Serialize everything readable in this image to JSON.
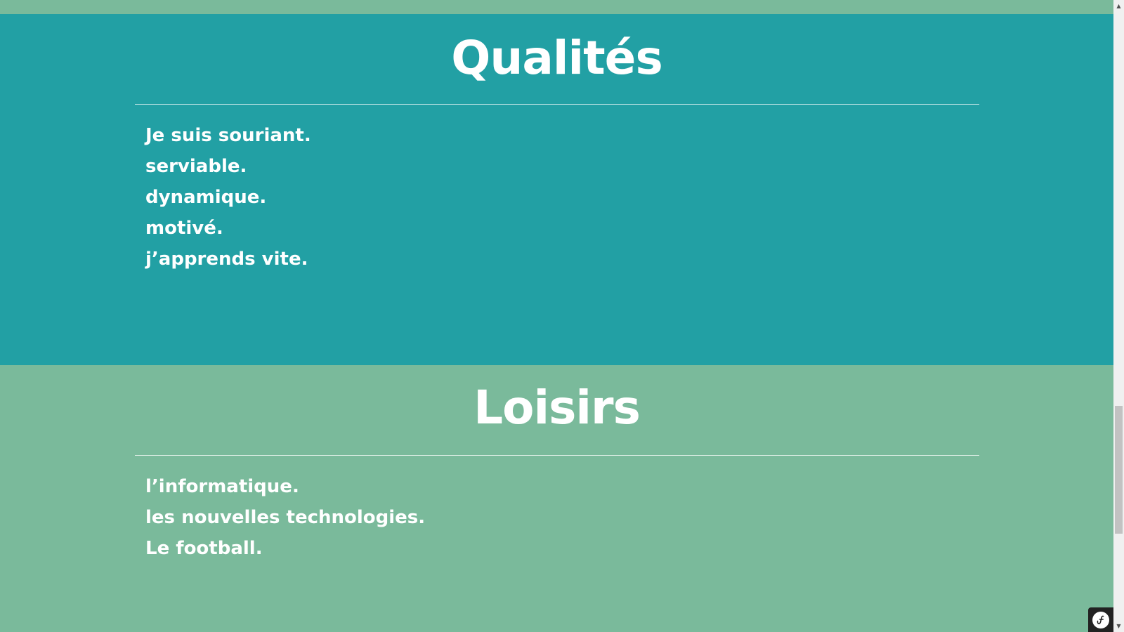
{
  "sections": {
    "qualites": {
      "title": "Qualités",
      "items": [
        "Je suis souriant.",
        "serviable.",
        "dynamique.",
        "motivé.",
        "j’apprends vite."
      ]
    },
    "loisirs": {
      "title": "Loisirs",
      "items": [
        "l’informatique.",
        "les nouvelles technologies.",
        "Le football."
      ]
    }
  },
  "scrollbar": {
    "up_arrow": "▲",
    "down_arrow": "▼",
    "scroll_fraction": 0.82
  },
  "colors": {
    "qualites_background": "#22a0a4",
    "loisirs_background": "#7aba9b",
    "text": "#ffffff",
    "toolbar_background": "#222222"
  },
  "icons": {
    "debug_toolbar": "symfony-logo-icon"
  }
}
